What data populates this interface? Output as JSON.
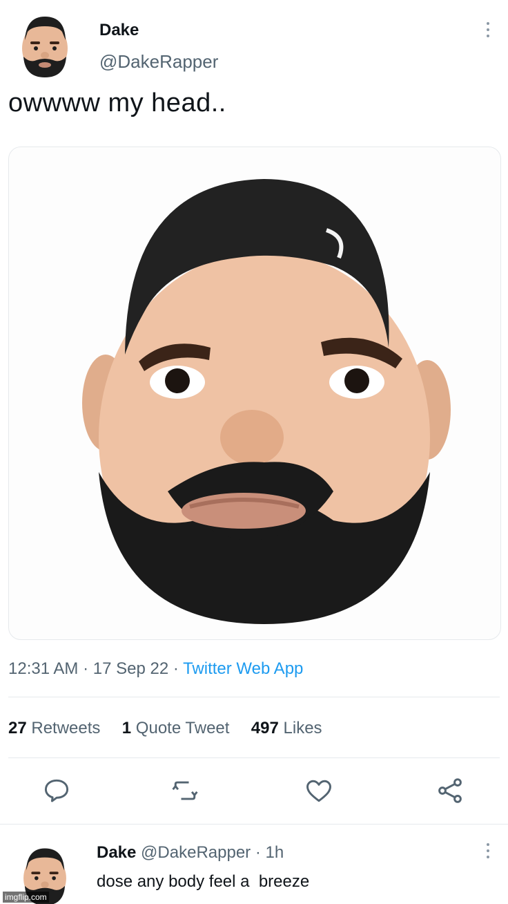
{
  "tweet": {
    "author_name": "Dake",
    "author_handle": "@DakeRapper",
    "text": "owwww my head..",
    "time": "12:31 AM",
    "date": "17 Sep 22",
    "source": "Twitter Web App",
    "separator": " · ",
    "stats": {
      "retweets_count": "27",
      "retweets_label": "Retweets",
      "quotes_count": "1",
      "quotes_label": "Quote Tweet",
      "likes_count": "497",
      "likes_label": "Likes"
    },
    "actions": [
      "reply-icon",
      "retweet-icon",
      "like-icon",
      "share-icon"
    ]
  },
  "reply": {
    "author_name": "Dake",
    "author_handle": "@DakeRapper",
    "time_ago": "1h",
    "separator": " · ",
    "text": "dose any body feel a  breeze"
  },
  "watermark": "imgflip.com",
  "colors": {
    "text": "#0f1419",
    "muted": "#536471",
    "link": "#1d9bf0",
    "divider": "#e6e9ec",
    "skin": "#e8b898",
    "hair": "#1e1e1e"
  }
}
